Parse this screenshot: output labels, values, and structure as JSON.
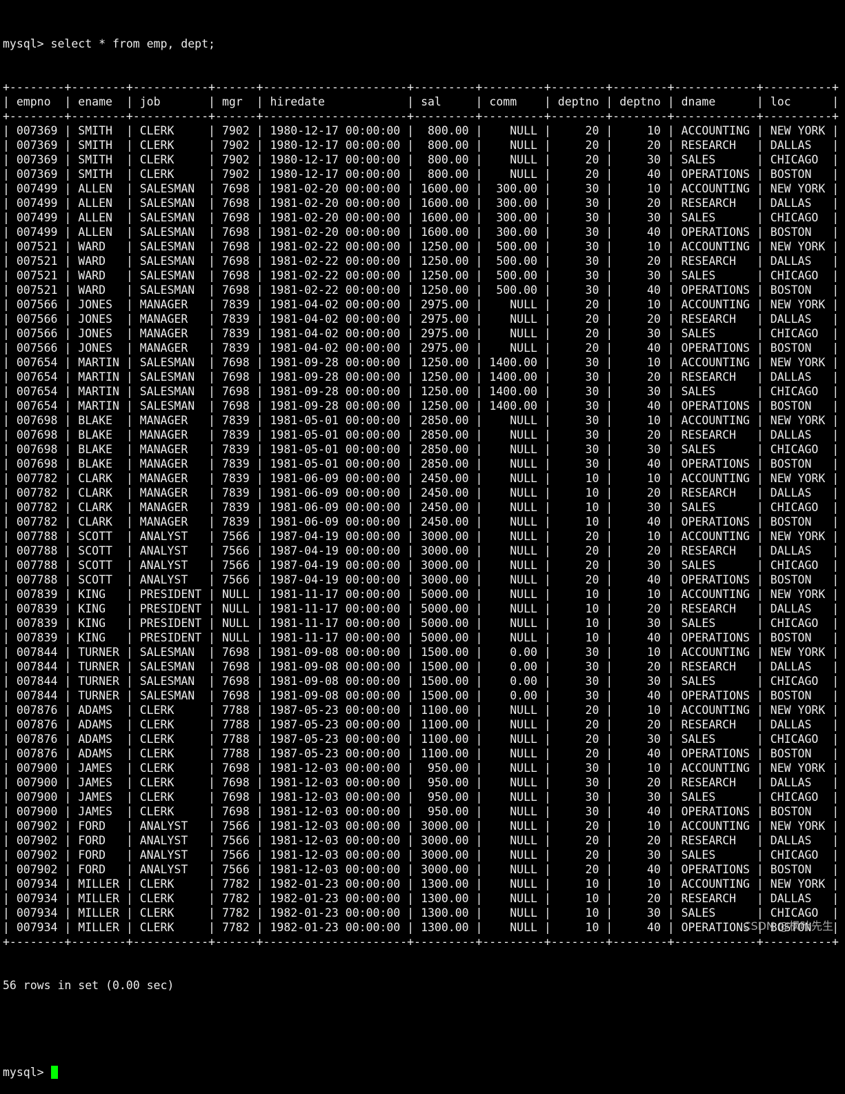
{
  "terminal": {
    "prompt": "mysql> ",
    "command": "select * from emp, dept;",
    "status": "56 rows in set (0.00 sec)",
    "cursor_color": "#00ff00"
  },
  "table": {
    "columns": [
      "empno",
      "ename",
      "job",
      "mgr",
      "hiredate",
      "sal",
      "comm",
      "deptno",
      "deptno",
      "dname",
      "loc"
    ],
    "right_aligned": [
      true,
      false,
      false,
      true,
      false,
      true,
      true,
      true,
      true,
      false,
      false
    ],
    "rows": [
      [
        "007369",
        "SMITH",
        "CLERK",
        "7902",
        "1980-12-17 00:00:00",
        "800.00",
        "NULL",
        "20",
        "10",
        "ACCOUNTING",
        "NEW YORK"
      ],
      [
        "007369",
        "SMITH",
        "CLERK",
        "7902",
        "1980-12-17 00:00:00",
        "800.00",
        "NULL",
        "20",
        "20",
        "RESEARCH",
        "DALLAS"
      ],
      [
        "007369",
        "SMITH",
        "CLERK",
        "7902",
        "1980-12-17 00:00:00",
        "800.00",
        "NULL",
        "20",
        "30",
        "SALES",
        "CHICAGO"
      ],
      [
        "007369",
        "SMITH",
        "CLERK",
        "7902",
        "1980-12-17 00:00:00",
        "800.00",
        "NULL",
        "20",
        "40",
        "OPERATIONS",
        "BOSTON"
      ],
      [
        "007499",
        "ALLEN",
        "SALESMAN",
        "7698",
        "1981-02-20 00:00:00",
        "1600.00",
        "300.00",
        "30",
        "10",
        "ACCOUNTING",
        "NEW YORK"
      ],
      [
        "007499",
        "ALLEN",
        "SALESMAN",
        "7698",
        "1981-02-20 00:00:00",
        "1600.00",
        "300.00",
        "30",
        "20",
        "RESEARCH",
        "DALLAS"
      ],
      [
        "007499",
        "ALLEN",
        "SALESMAN",
        "7698",
        "1981-02-20 00:00:00",
        "1600.00",
        "300.00",
        "30",
        "30",
        "SALES",
        "CHICAGO"
      ],
      [
        "007499",
        "ALLEN",
        "SALESMAN",
        "7698",
        "1981-02-20 00:00:00",
        "1600.00",
        "300.00",
        "30",
        "40",
        "OPERATIONS",
        "BOSTON"
      ],
      [
        "007521",
        "WARD",
        "SALESMAN",
        "7698",
        "1981-02-22 00:00:00",
        "1250.00",
        "500.00",
        "30",
        "10",
        "ACCOUNTING",
        "NEW YORK"
      ],
      [
        "007521",
        "WARD",
        "SALESMAN",
        "7698",
        "1981-02-22 00:00:00",
        "1250.00",
        "500.00",
        "30",
        "20",
        "RESEARCH",
        "DALLAS"
      ],
      [
        "007521",
        "WARD",
        "SALESMAN",
        "7698",
        "1981-02-22 00:00:00",
        "1250.00",
        "500.00",
        "30",
        "30",
        "SALES",
        "CHICAGO"
      ],
      [
        "007521",
        "WARD",
        "SALESMAN",
        "7698",
        "1981-02-22 00:00:00",
        "1250.00",
        "500.00",
        "30",
        "40",
        "OPERATIONS",
        "BOSTON"
      ],
      [
        "007566",
        "JONES",
        "MANAGER",
        "7839",
        "1981-04-02 00:00:00",
        "2975.00",
        "NULL",
        "20",
        "10",
        "ACCOUNTING",
        "NEW YORK"
      ],
      [
        "007566",
        "JONES",
        "MANAGER",
        "7839",
        "1981-04-02 00:00:00",
        "2975.00",
        "NULL",
        "20",
        "20",
        "RESEARCH",
        "DALLAS"
      ],
      [
        "007566",
        "JONES",
        "MANAGER",
        "7839",
        "1981-04-02 00:00:00",
        "2975.00",
        "NULL",
        "20",
        "30",
        "SALES",
        "CHICAGO"
      ],
      [
        "007566",
        "JONES",
        "MANAGER",
        "7839",
        "1981-04-02 00:00:00",
        "2975.00",
        "NULL",
        "20",
        "40",
        "OPERATIONS",
        "BOSTON"
      ],
      [
        "007654",
        "MARTIN",
        "SALESMAN",
        "7698",
        "1981-09-28 00:00:00",
        "1250.00",
        "1400.00",
        "30",
        "10",
        "ACCOUNTING",
        "NEW YORK"
      ],
      [
        "007654",
        "MARTIN",
        "SALESMAN",
        "7698",
        "1981-09-28 00:00:00",
        "1250.00",
        "1400.00",
        "30",
        "20",
        "RESEARCH",
        "DALLAS"
      ],
      [
        "007654",
        "MARTIN",
        "SALESMAN",
        "7698",
        "1981-09-28 00:00:00",
        "1250.00",
        "1400.00",
        "30",
        "30",
        "SALES",
        "CHICAGO"
      ],
      [
        "007654",
        "MARTIN",
        "SALESMAN",
        "7698",
        "1981-09-28 00:00:00",
        "1250.00",
        "1400.00",
        "30",
        "40",
        "OPERATIONS",
        "BOSTON"
      ],
      [
        "007698",
        "BLAKE",
        "MANAGER",
        "7839",
        "1981-05-01 00:00:00",
        "2850.00",
        "NULL",
        "30",
        "10",
        "ACCOUNTING",
        "NEW YORK"
      ],
      [
        "007698",
        "BLAKE",
        "MANAGER",
        "7839",
        "1981-05-01 00:00:00",
        "2850.00",
        "NULL",
        "30",
        "20",
        "RESEARCH",
        "DALLAS"
      ],
      [
        "007698",
        "BLAKE",
        "MANAGER",
        "7839",
        "1981-05-01 00:00:00",
        "2850.00",
        "NULL",
        "30",
        "30",
        "SALES",
        "CHICAGO"
      ],
      [
        "007698",
        "BLAKE",
        "MANAGER",
        "7839",
        "1981-05-01 00:00:00",
        "2850.00",
        "NULL",
        "30",
        "40",
        "OPERATIONS",
        "BOSTON"
      ],
      [
        "007782",
        "CLARK",
        "MANAGER",
        "7839",
        "1981-06-09 00:00:00",
        "2450.00",
        "NULL",
        "10",
        "10",
        "ACCOUNTING",
        "NEW YORK"
      ],
      [
        "007782",
        "CLARK",
        "MANAGER",
        "7839",
        "1981-06-09 00:00:00",
        "2450.00",
        "NULL",
        "10",
        "20",
        "RESEARCH",
        "DALLAS"
      ],
      [
        "007782",
        "CLARK",
        "MANAGER",
        "7839",
        "1981-06-09 00:00:00",
        "2450.00",
        "NULL",
        "10",
        "30",
        "SALES",
        "CHICAGO"
      ],
      [
        "007782",
        "CLARK",
        "MANAGER",
        "7839",
        "1981-06-09 00:00:00",
        "2450.00",
        "NULL",
        "10",
        "40",
        "OPERATIONS",
        "BOSTON"
      ],
      [
        "007788",
        "SCOTT",
        "ANALYST",
        "7566",
        "1987-04-19 00:00:00",
        "3000.00",
        "NULL",
        "20",
        "10",
        "ACCOUNTING",
        "NEW YORK"
      ],
      [
        "007788",
        "SCOTT",
        "ANALYST",
        "7566",
        "1987-04-19 00:00:00",
        "3000.00",
        "NULL",
        "20",
        "20",
        "RESEARCH",
        "DALLAS"
      ],
      [
        "007788",
        "SCOTT",
        "ANALYST",
        "7566",
        "1987-04-19 00:00:00",
        "3000.00",
        "NULL",
        "20",
        "30",
        "SALES",
        "CHICAGO"
      ],
      [
        "007788",
        "SCOTT",
        "ANALYST",
        "7566",
        "1987-04-19 00:00:00",
        "3000.00",
        "NULL",
        "20",
        "40",
        "OPERATIONS",
        "BOSTON"
      ],
      [
        "007839",
        "KING",
        "PRESIDENT",
        "NULL",
        "1981-11-17 00:00:00",
        "5000.00",
        "NULL",
        "10",
        "10",
        "ACCOUNTING",
        "NEW YORK"
      ],
      [
        "007839",
        "KING",
        "PRESIDENT",
        "NULL",
        "1981-11-17 00:00:00",
        "5000.00",
        "NULL",
        "10",
        "20",
        "RESEARCH",
        "DALLAS"
      ],
      [
        "007839",
        "KING",
        "PRESIDENT",
        "NULL",
        "1981-11-17 00:00:00",
        "5000.00",
        "NULL",
        "10",
        "30",
        "SALES",
        "CHICAGO"
      ],
      [
        "007839",
        "KING",
        "PRESIDENT",
        "NULL",
        "1981-11-17 00:00:00",
        "5000.00",
        "NULL",
        "10",
        "40",
        "OPERATIONS",
        "BOSTON"
      ],
      [
        "007844",
        "TURNER",
        "SALESMAN",
        "7698",
        "1981-09-08 00:00:00",
        "1500.00",
        "0.00",
        "30",
        "10",
        "ACCOUNTING",
        "NEW YORK"
      ],
      [
        "007844",
        "TURNER",
        "SALESMAN",
        "7698",
        "1981-09-08 00:00:00",
        "1500.00",
        "0.00",
        "30",
        "20",
        "RESEARCH",
        "DALLAS"
      ],
      [
        "007844",
        "TURNER",
        "SALESMAN",
        "7698",
        "1981-09-08 00:00:00",
        "1500.00",
        "0.00",
        "30",
        "30",
        "SALES",
        "CHICAGO"
      ],
      [
        "007844",
        "TURNER",
        "SALESMAN",
        "7698",
        "1981-09-08 00:00:00",
        "1500.00",
        "0.00",
        "30",
        "40",
        "OPERATIONS",
        "BOSTON"
      ],
      [
        "007876",
        "ADAMS",
        "CLERK",
        "7788",
        "1987-05-23 00:00:00",
        "1100.00",
        "NULL",
        "20",
        "10",
        "ACCOUNTING",
        "NEW YORK"
      ],
      [
        "007876",
        "ADAMS",
        "CLERK",
        "7788",
        "1987-05-23 00:00:00",
        "1100.00",
        "NULL",
        "20",
        "20",
        "RESEARCH",
        "DALLAS"
      ],
      [
        "007876",
        "ADAMS",
        "CLERK",
        "7788",
        "1987-05-23 00:00:00",
        "1100.00",
        "NULL",
        "20",
        "30",
        "SALES",
        "CHICAGO"
      ],
      [
        "007876",
        "ADAMS",
        "CLERK",
        "7788",
        "1987-05-23 00:00:00",
        "1100.00",
        "NULL",
        "20",
        "40",
        "OPERATIONS",
        "BOSTON"
      ],
      [
        "007900",
        "JAMES",
        "CLERK",
        "7698",
        "1981-12-03 00:00:00",
        "950.00",
        "NULL",
        "30",
        "10",
        "ACCOUNTING",
        "NEW YORK"
      ],
      [
        "007900",
        "JAMES",
        "CLERK",
        "7698",
        "1981-12-03 00:00:00",
        "950.00",
        "NULL",
        "30",
        "20",
        "RESEARCH",
        "DALLAS"
      ],
      [
        "007900",
        "JAMES",
        "CLERK",
        "7698",
        "1981-12-03 00:00:00",
        "950.00",
        "NULL",
        "30",
        "30",
        "SALES",
        "CHICAGO"
      ],
      [
        "007900",
        "JAMES",
        "CLERK",
        "7698",
        "1981-12-03 00:00:00",
        "950.00",
        "NULL",
        "30",
        "40",
        "OPERATIONS",
        "BOSTON"
      ],
      [
        "007902",
        "FORD",
        "ANALYST",
        "7566",
        "1981-12-03 00:00:00",
        "3000.00",
        "NULL",
        "20",
        "10",
        "ACCOUNTING",
        "NEW YORK"
      ],
      [
        "007902",
        "FORD",
        "ANALYST",
        "7566",
        "1981-12-03 00:00:00",
        "3000.00",
        "NULL",
        "20",
        "20",
        "RESEARCH",
        "DALLAS"
      ],
      [
        "007902",
        "FORD",
        "ANALYST",
        "7566",
        "1981-12-03 00:00:00",
        "3000.00",
        "NULL",
        "20",
        "30",
        "SALES",
        "CHICAGO"
      ],
      [
        "007902",
        "FORD",
        "ANALYST",
        "7566",
        "1981-12-03 00:00:00",
        "3000.00",
        "NULL",
        "20",
        "40",
        "OPERATIONS",
        "BOSTON"
      ],
      [
        "007934",
        "MILLER",
        "CLERK",
        "7782",
        "1982-01-23 00:00:00",
        "1300.00",
        "NULL",
        "10",
        "10",
        "ACCOUNTING",
        "NEW YORK"
      ],
      [
        "007934",
        "MILLER",
        "CLERK",
        "7782",
        "1982-01-23 00:00:00",
        "1300.00",
        "NULL",
        "10",
        "20",
        "RESEARCH",
        "DALLAS"
      ],
      [
        "007934",
        "MILLER",
        "CLERK",
        "7782",
        "1982-01-23 00:00:00",
        "1300.00",
        "NULL",
        "10",
        "30",
        "SALES",
        "CHICAGO"
      ],
      [
        "007934",
        "MILLER",
        "CLERK",
        "7782",
        "1982-01-23 00:00:00",
        "1300.00",
        "NULL",
        "10",
        "40",
        "OPERATIONS",
        "BOSTON"
      ]
    ]
  },
  "watermark": "CSDN @枫叶先生"
}
